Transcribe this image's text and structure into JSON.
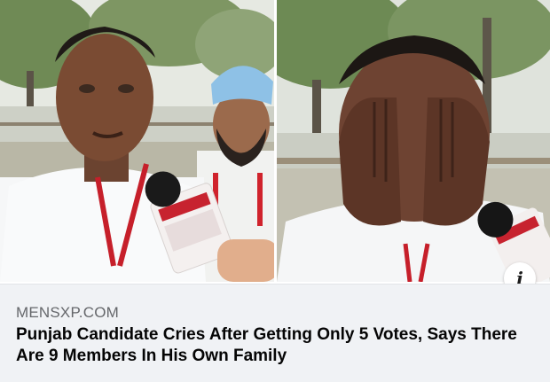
{
  "link_preview": {
    "domain": "MENSXP.COM",
    "headline": "Punjab Candidate Cries After Getting Only 5 Votes, Says There Are 9 Members In His Own Family",
    "info_icon": "i",
    "images": [
      {
        "name": "candidate-interview-photo"
      },
      {
        "name": "candidate-crying-photo"
      }
    ]
  },
  "colors": {
    "meta_background": "#f0f2f5",
    "domain_text": "#65676b",
    "headline_text": "#050505"
  }
}
